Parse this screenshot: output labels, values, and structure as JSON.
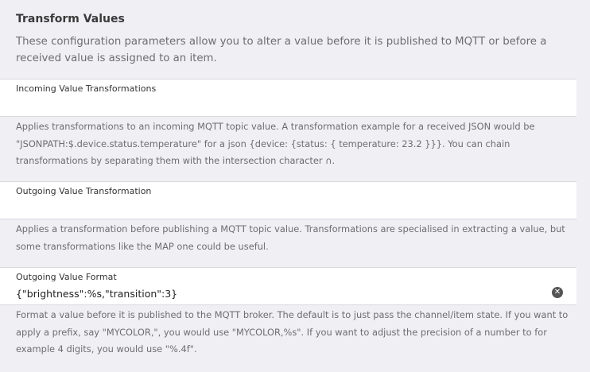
{
  "section": {
    "title": "Transform Values",
    "description": "These configuration parameters allow you to alter a value before it is published to MQTT or before a received value is assigned to an item."
  },
  "fields": [
    {
      "label": "Incoming Value Transformations",
      "value": "",
      "hint": "Applies transformations to an incoming MQTT topic value. A transformation example for a received JSON would be \"JSONPATH:$.device.status.temperature\" for a json {device: {status: { temperature: 23.2 }}}. You can chain transformations by separating them with the intersection character ∩."
    },
    {
      "label": "Outgoing Value Transformation",
      "value": "",
      "hint": "Applies a transformation before publishing a MQTT topic value. Transformations are specialised in extracting a value, but some transformations like the MAP one could be useful."
    },
    {
      "label": "Outgoing Value Format",
      "value": "{\"brightness\":%s,\"transition\":3}",
      "clear_icon": "clear-circle-icon",
      "hint": "Format a value before it is published to the MQTT broker. The default is to just pass the channel/item state. If you want to apply a prefix, say \"MYCOLOR,\", you would use \"MYCOLOR,%s\". If you want to adjust the precision of a number to for example 4 digits, you would use \"%.4f\"."
    }
  ]
}
